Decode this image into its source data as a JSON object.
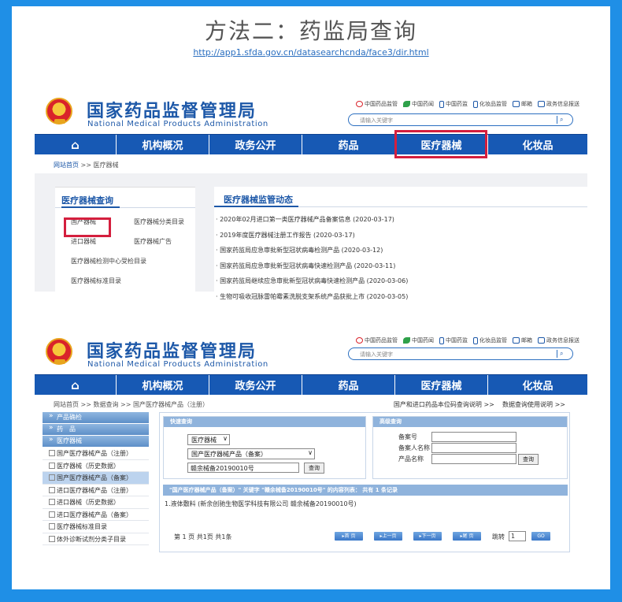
{
  "heading": "方法二：药监局查询",
  "url": "http://app1.sfda.gov.cn/datasearchcnda/face3/dir.html",
  "site": {
    "name_cn": "国家药品监督管理局",
    "name_en": "National Medical Products Administration",
    "top_links": [
      "中国药品监管",
      "中国药闻",
      "中国药监",
      "化妆品监管",
      "邮箱",
      "政务信息报送"
    ],
    "search_placeholder": "请输入关键字",
    "nav": [
      "机构概况",
      "政务公开",
      "药品",
      "医疗器械",
      "化妆品"
    ]
  },
  "screen1": {
    "breadcrumb": [
      "网站首页",
      " >> 医疗器械"
    ],
    "query_title": "医疗器械查询",
    "query_links": [
      "国产器械",
      "医疗器械分类目录",
      "进口器械",
      "医疗器械广告",
      "医疗器械检测中心受检目录",
      "医疗器械标准目录"
    ],
    "news_title": "医疗器械监管动态",
    "news": [
      "· 2020年02月进口第一类医疗器械产品备案信息 (2020-03-17)",
      "· 2019年度医疗器械注册工作报告 (2020-03-17)",
      "· 国家药监局应急审批新型冠状病毒检测产品 (2020-03-12)",
      "· 国家药监局应急审批新型冠状病毒快速检测产品 (2020-03-11)",
      "· 国家药监局继续应急审批新型冠状病毒快速检测产品 (2020-03-06)",
      "· 生物可吸收冠脉雷帕霉素洗脱支架系统产品获批上市 (2020-03-05)"
    ]
  },
  "screen2": {
    "breadcrumb": "网站首页 >> 数据查询 >> 国产医疗器械产品（注册）",
    "top_right": [
      "国产和进口药品本位码查询说明 >>",
      "数据查询使用说明 >>"
    ],
    "sidebar_headers": [
      "产品确检",
      "药　品",
      "医疗器械"
    ],
    "sidebar_items": [
      "国产医疗器械产品（注册）",
      "医疗器械（历史数据）",
      "国产医疗器械产品（备案）",
      "进口医疗器械产品（注册）",
      "进口器械（历史数据）",
      "进口医疗器械产品（备案）",
      "医疗器械标准目录",
      "体外诊断试剂分类子目录"
    ],
    "quick": {
      "title": "快速查询",
      "select1": "医疗器械",
      "select2": "国产医疗器械产品（备案）",
      "keyword": "赣余械备20190010号",
      "button": "查询"
    },
    "advanced": {
      "title": "高级查询",
      "labels": [
        "备案号",
        "备案人名称",
        "产品名称"
      ],
      "button": "查询"
    },
    "result_bar": "\"国产医疗器械产品（备案）\" 关键字 \"赣余械备20190010号\" 的内容列表：  共有 1 条记录",
    "result_item": "1.液体敷料 (新余创驰生物医学科技有限公司 赣余械备20190010号)",
    "pager_text": "第 1 页 共1页 共1条",
    "pager_buttons": [
      "首 页",
      "上一页",
      "下一页",
      "尾 页"
    ],
    "jump_label": "跳转",
    "jump_value": "1",
    "go": "GO"
  }
}
